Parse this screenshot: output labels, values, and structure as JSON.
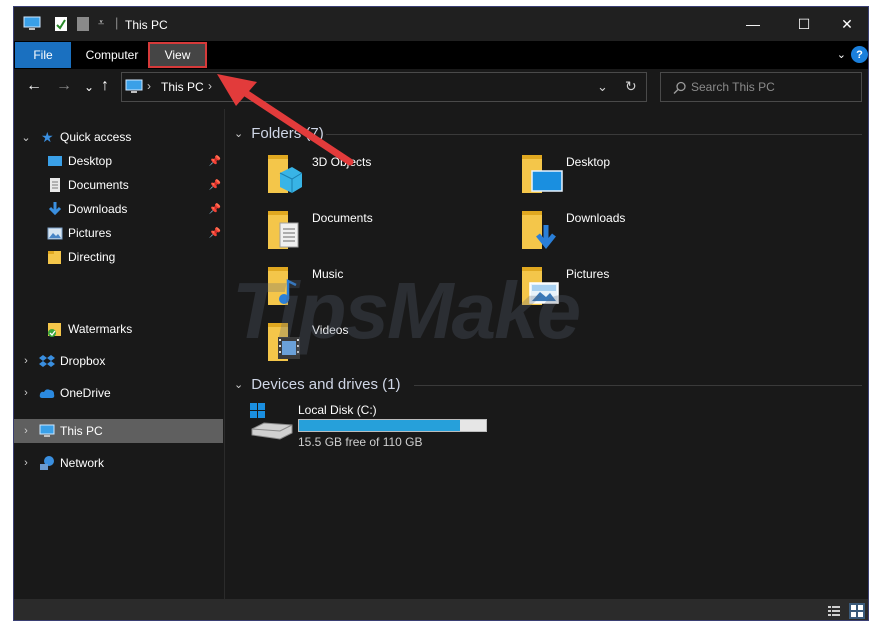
{
  "window": {
    "title": "This PC",
    "controls": {
      "minimize": "—",
      "maximize": "☐",
      "close": "✕"
    }
  },
  "ribbon": {
    "tabs": [
      {
        "label": "File"
      },
      {
        "label": "Computer"
      },
      {
        "label": "View"
      }
    ],
    "help": "?"
  },
  "nav": {
    "back": "←",
    "forward": "→",
    "recent": "⌄",
    "up": "↑",
    "breadcrumb": [
      "This PC"
    ],
    "search_placeholder": "Search This PC"
  },
  "sidebar": {
    "quick_access": "Quick access",
    "quick_items": [
      {
        "label": "Desktop",
        "pinned": true
      },
      {
        "label": "Documents",
        "pinned": true
      },
      {
        "label": "Downloads",
        "pinned": true
      },
      {
        "label": "Pictures",
        "pinned": true
      },
      {
        "label": "Directing",
        "pinned": false
      },
      {
        "label": "Watermarks",
        "pinned": false
      }
    ],
    "roots": [
      {
        "label": "Dropbox"
      },
      {
        "label": "OneDrive"
      },
      {
        "label": "This PC",
        "selected": true
      },
      {
        "label": "Network"
      }
    ]
  },
  "content": {
    "folders_header": "Folders (7)",
    "folders": [
      {
        "name": "3D Objects"
      },
      {
        "name": "Desktop"
      },
      {
        "name": "Documents"
      },
      {
        "name": "Downloads"
      },
      {
        "name": "Music"
      },
      {
        "name": "Pictures"
      },
      {
        "name": "Videos"
      }
    ],
    "devices_header": "Devices and drives (1)",
    "drives": [
      {
        "name": "Local Disk (C:)",
        "free_text": "15.5 GB free of 110 GB",
        "used_fraction": 0.859
      }
    ]
  },
  "watermark": "TipsMake",
  "colors": {
    "accent": "#1a70c0",
    "selection": "#5f5f5f",
    "annotation": "#e23b3b",
    "drive_fill": "#26a0da"
  }
}
